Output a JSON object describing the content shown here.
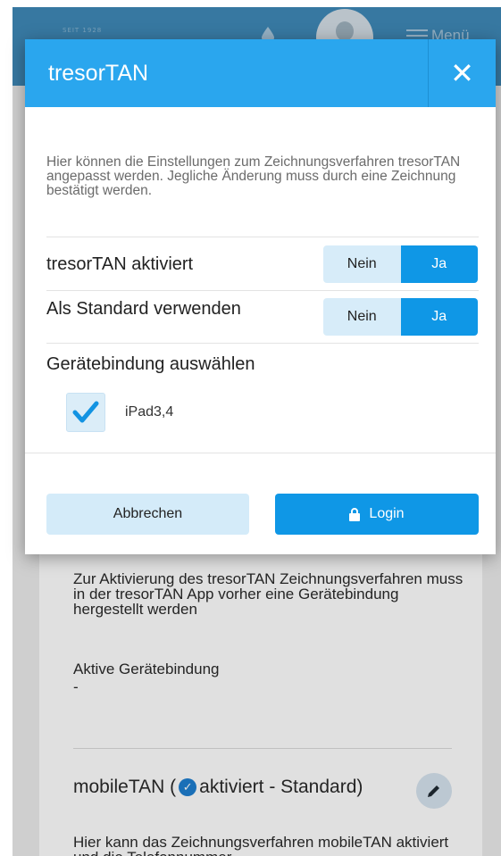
{
  "background": {
    "logo_text": "SEIT 1928",
    "menu_label": "Menü",
    "activation_text": "Zur Aktivierung des tresorTAN Zeichnungsverfahren muss in der tresorTAN App vorher eine Gerätebindung hergestellt werden",
    "active_binding_label": "Aktive Gerätebindung",
    "active_binding_value": "-",
    "mobiletan": {
      "prefix": "mobileTAN (",
      "status": "aktiviert - Standard)"
    },
    "mobiletan_desc": "Hier kann das Zeichnungsverfahren mobileTAN aktiviert und die Telefonnummer"
  },
  "dialog": {
    "title": "tresorTAN",
    "description": "Hier können die Einstellungen zum Zeichnungsverfahren tresorTAN angepasst werden. Jegliche Änderung muss durch eine Zeichnung bestätigt werden.",
    "settings": [
      {
        "label": "tresorTAN aktiviert",
        "no": "Nein",
        "yes": "Ja",
        "selected": "Ja"
      },
      {
        "label": "Als Standard verwenden",
        "no": "Nein",
        "yes": "Ja",
        "selected": "Ja"
      }
    ],
    "device_section_title": "Gerätebindung auswählen",
    "devices": [
      {
        "name": "iPad3,4",
        "checked": true
      }
    ],
    "cancel_label": "Abbrechen",
    "login_label": "Login"
  },
  "colors": {
    "header_blue": "#2aa6ee",
    "toggle_on": "#0f97e6",
    "toggle_off": "#d7ecf9"
  },
  "icons": [
    "close-icon",
    "check-icon",
    "lock-icon",
    "pencil-icon",
    "menu-icon",
    "avatar-icon"
  ]
}
